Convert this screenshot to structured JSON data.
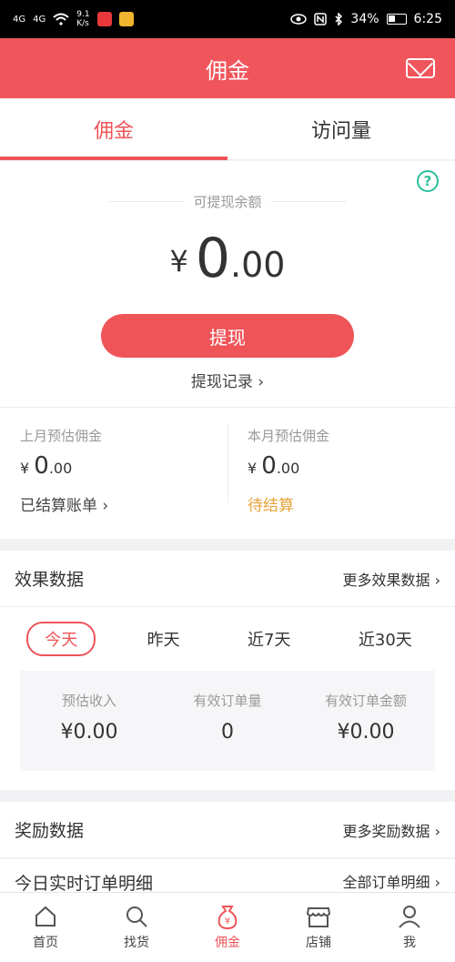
{
  "status_bar": {
    "signal1": "4G",
    "signal2": "4G",
    "net_speed_value": "9.1",
    "net_speed_unit": "K/s",
    "battery": "34%",
    "time": "6:25"
  },
  "header": {
    "title": "佣金"
  },
  "tabs": [
    {
      "label": "佣金",
      "active": true
    },
    {
      "label": "访问量",
      "active": false
    }
  ],
  "balance": {
    "label": "可提现余额",
    "currency": "¥",
    "integer": "0",
    "decimal": ".00",
    "withdraw_label": "提现",
    "record_label": "提现记录 ›"
  },
  "commission": {
    "last_month": {
      "label": "上月预估佣金",
      "currency": "¥",
      "integer": "0",
      "decimal": ".00",
      "link": "已结算账单 ›"
    },
    "this_month": {
      "label": "本月预估佣金",
      "currency": "¥",
      "integer": "0",
      "decimal": ".00",
      "link": "待结算"
    }
  },
  "effect": {
    "title": "效果数据",
    "more": "更多效果数据 ›",
    "date_tabs": [
      "今天",
      "昨天",
      "近7天",
      "近30天"
    ],
    "stats": [
      {
        "label": "预估收入",
        "value": "¥0.00"
      },
      {
        "label": "有效订单量",
        "value": "0"
      },
      {
        "label": "有效订单金额",
        "value": "¥0.00"
      }
    ]
  },
  "reward": {
    "title": "奖励数据",
    "more": "更多奖励数据 ›"
  },
  "orders": {
    "title": "今日实时订单明细",
    "more": "全部订单明细 ›"
  },
  "bottom_nav": [
    {
      "label": "首页",
      "icon": "home-icon"
    },
    {
      "label": "找货",
      "icon": "search-icon"
    },
    {
      "label": "佣金",
      "icon": "money-bag-icon"
    },
    {
      "label": "店铺",
      "icon": "store-icon"
    },
    {
      "label": "我",
      "icon": "user-icon"
    }
  ],
  "colors": {
    "brand": "#f0555c",
    "accent": "#ee5458",
    "pending": "#e8a33a",
    "help": "#2bbf9a"
  }
}
